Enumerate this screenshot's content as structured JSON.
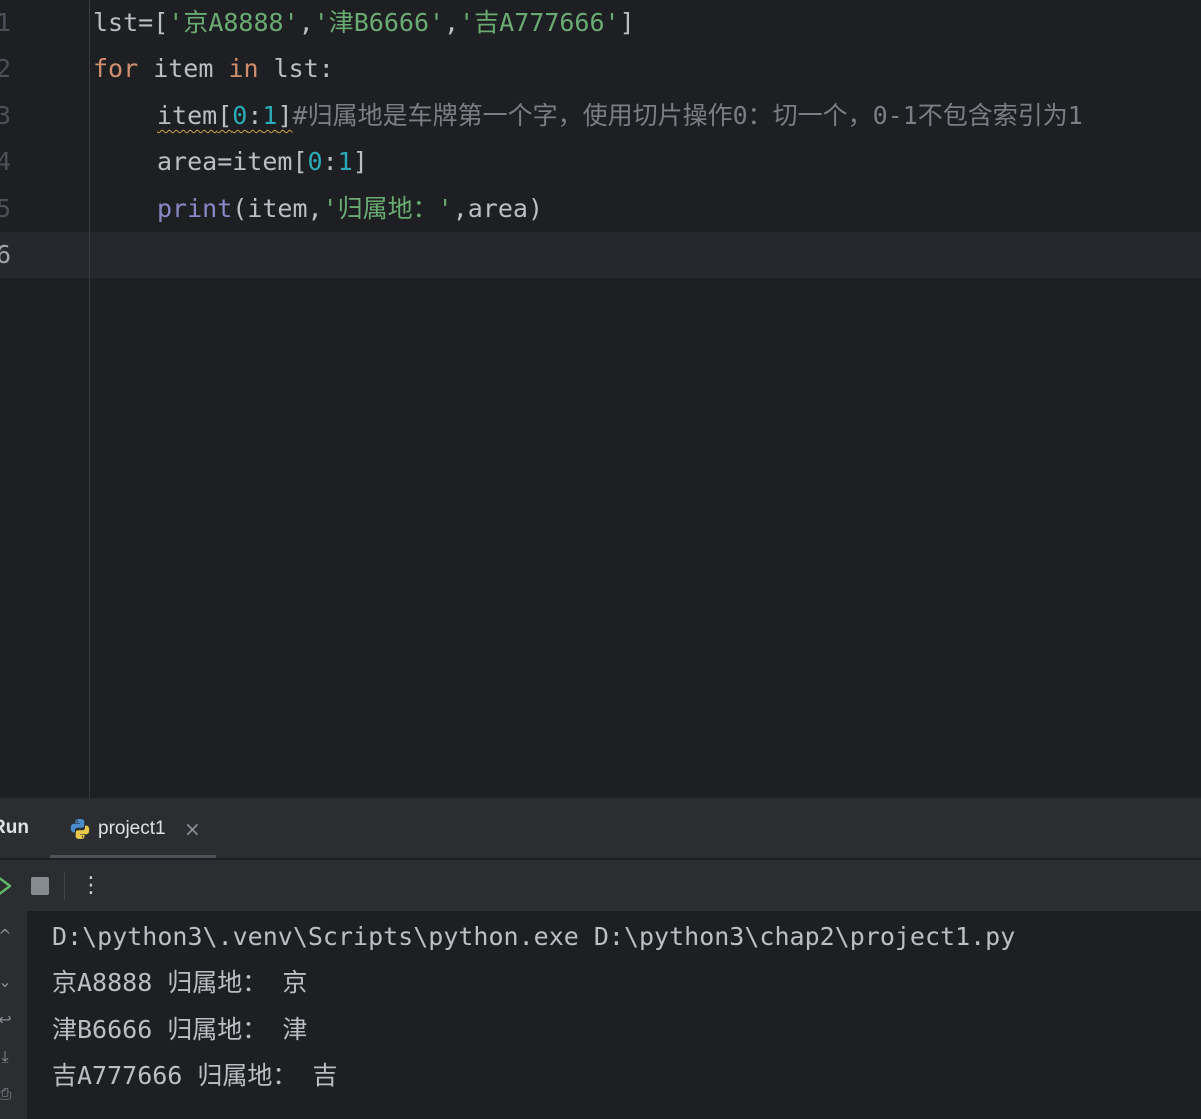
{
  "editor": {
    "line_numbers": [
      "1",
      "2",
      "3",
      "4",
      "5",
      "6"
    ],
    "lines": [
      {
        "t1": "lst=[",
        "s1": "'京A8888'",
        "t2": ",",
        "s2": "'津B6666'",
        "t3": ",",
        "s3": "'吉A777666'",
        "t4": "]"
      },
      {
        "kw1": "for",
        "t1": " item ",
        "kw2": "in",
        "t2": " lst:"
      },
      {
        "w_name": "item",
        "w_open": "[",
        "w_n0": "0",
        "w_colon": ":",
        "w_n1": "1",
        "w_close": "]",
        "comment": "#归属地是车牌第一个字，使用切片操作0：切一个，0-1不包含索引为1"
      },
      {
        "t1": "area=item[",
        "n0": "0",
        "t2": ":",
        "n1": "1",
        "t3": "]"
      },
      {
        "bi": "print",
        "t1": "(item,",
        "s1": "'归属地：'",
        "t2": ",area)"
      }
    ]
  },
  "run_panel": {
    "title": "Run",
    "tab_label": "project1",
    "tab_icon": "python-icon",
    "close_glyph": "×",
    "more_glyph": "⋮",
    "console_lines": [
      "D:\\python3\\.venv\\Scripts\\python.exe D:\\python3\\chap2\\project1.py",
      "京A8888 归属地： 京",
      "津B6666 归属地： 津",
      "吉A777666 归属地： 吉"
    ]
  },
  "colors": {
    "background": "#1e1f22",
    "panel": "#2b2d30",
    "keyword": "#cf8e6d",
    "string": "#6aab73",
    "number": "#2aacb8",
    "comment": "#7a7e85",
    "builtin": "#8888c6",
    "text": "#bcbec4"
  }
}
